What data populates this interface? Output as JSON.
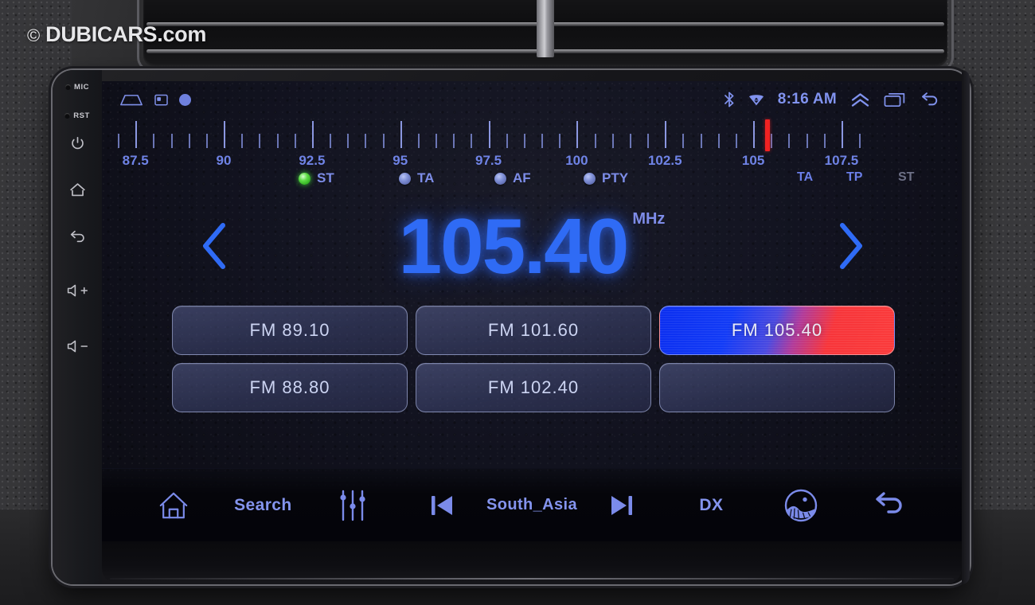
{
  "watermark": {
    "mark": "©",
    "brand": "DUBICARS",
    "tail": ".com"
  },
  "bezel": {
    "mic_label": "MIC",
    "rst_label": "RST",
    "power_icon": "power-icon",
    "home_icon": "home-icon",
    "back_icon": "back-icon",
    "volume_up_icon": "volume-up-icon",
    "volume_down_icon": "volume-down-icon"
  },
  "statusbar": {
    "left_icons": [
      "home-outline-icon",
      "screenshot-icon",
      "circle-icon"
    ],
    "bluetooth_icon": "bluetooth-icon",
    "wifi_icon": "wifi-icon",
    "clock": "8:16 AM",
    "chevron_up_icon": "chevron-double-up-icon",
    "recents_icon": "recents-icon",
    "back_icon": "back-arrow-icon",
    "accent": "#7e8fe8"
  },
  "radio": {
    "band": "FM",
    "frequency": "105.40",
    "unit": "MHz",
    "prev_icon": "chevron-left-icon",
    "next_icon": "chevron-right-icon",
    "needle_color": "#f12222",
    "frequency_color": "#2f6bf5",
    "indicators": [
      {
        "label": "ST",
        "state": "on"
      },
      {
        "label": "TA",
        "state": "off"
      },
      {
        "label": "AF",
        "state": "off"
      },
      {
        "label": "PTY",
        "state": "off"
      }
    ],
    "rds_flags": [
      {
        "label": "TA",
        "state": "active"
      },
      {
        "label": "TP",
        "state": "active"
      },
      {
        "label": "ST",
        "state": "dim"
      }
    ]
  },
  "chart_data": {
    "type": "line",
    "title": "FM tuning scale",
    "xlabel": "MHz",
    "ylabel": "",
    "xlim": [
      87.0,
      108.2
    ],
    "grid": false,
    "legend": "none",
    "tick_labels": [
      "87.5",
      "90",
      "92.5",
      "95",
      "97.5",
      "100",
      "102.5",
      "105",
      "107.5"
    ],
    "major_ticks": [
      87.5,
      90,
      92.5,
      95,
      97.5,
      100,
      102.5,
      105,
      107.5
    ],
    "minor_tick_step": 0.5,
    "marker_value": 105.4,
    "marker_label": "105.40"
  },
  "presets": [
    {
      "band": "FM",
      "freq": "89.10",
      "label": "FM  89.10",
      "active": false,
      "empty": false
    },
    {
      "band": "FM",
      "freq": "101.60",
      "label": "FM  101.60",
      "active": false,
      "empty": false
    },
    {
      "band": "FM",
      "freq": "105.40",
      "label": "FM  105.40",
      "active": true,
      "empty": false
    },
    {
      "band": "FM",
      "freq": "88.80",
      "label": "FM  88.80",
      "active": false,
      "empty": false
    },
    {
      "band": "FM",
      "freq": "102.40",
      "label": "FM  102.40",
      "active": false,
      "empty": false
    },
    {
      "band": "",
      "freq": "",
      "label": "",
      "active": false,
      "empty": true
    }
  ],
  "toolbar": {
    "home_icon": "home-icon",
    "search_label": "Search",
    "equalizer_icon": "equalizer-icon",
    "prev_icon": "skip-previous-icon",
    "region_label": "South_Asia",
    "next_icon": "skip-next-icon",
    "dx_label": "DX",
    "gallery_icon": "landscape-photo-icon",
    "back_icon": "back-arrow-icon"
  }
}
